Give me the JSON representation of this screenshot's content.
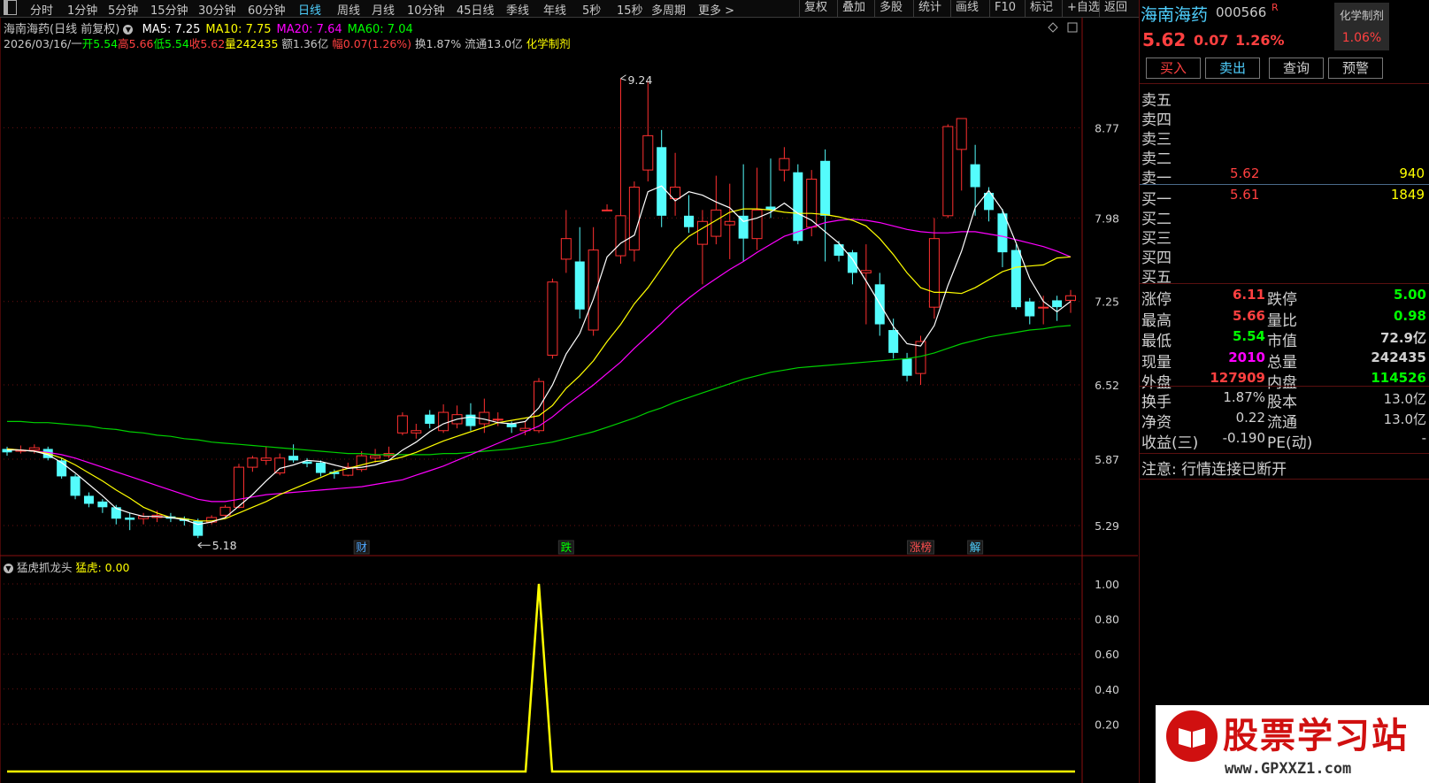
{
  "toolbar": {
    "menu_icon": "window-menu-icon",
    "periods": [
      "分时",
      "1分钟",
      "5分钟",
      "15分钟",
      "30分钟",
      "60分钟",
      "日线",
      "周线",
      "月线",
      "10分钟",
      "45日线",
      "季线",
      "年线",
      "5秒",
      "15秒",
      "多周期",
      "更多 >"
    ],
    "active_period": "日线",
    "right_buttons": [
      "复权",
      "叠加",
      "多股",
      "统计",
      "画线",
      "F10",
      "标记",
      "+自选",
      "返回"
    ]
  },
  "main_chart": {
    "title": "海南海药(日线 前复权)",
    "ma": [
      {
        "label": "MA5: 7.25",
        "color": "#ffffff"
      },
      {
        "label": "MA10: 7.75",
        "color": "#ffff00"
      },
      {
        "label": "MA20: 7.64",
        "color": "#ff00ff"
      },
      {
        "label": "MA60: 7.04",
        "color": "#00ff00"
      }
    ],
    "date": "2026/03/16/一",
    "open_label": "开",
    "open": "5.54",
    "high_label": "高",
    "high": "5.66",
    "low_label": "低",
    "low": "5.54",
    "close_label": "收",
    "close": "5.62",
    "vol_label": "量",
    "vol": "242435",
    "amount": "额1.36亿",
    "change_label": "幅",
    "change": "0.07(1.26%)",
    "turnover": "换1.87%",
    "float_shares": "流通13.0亿",
    "sector": "化学制剂",
    "high_marker": "9.24",
    "low_marker": "5.18",
    "event_tags": [
      {
        "text": "财",
        "color": "#4fa8ff"
      },
      {
        "text": "跌",
        "color": "#00ff00"
      },
      {
        "text": "涨榜",
        "color": "#ff5050"
      },
      {
        "text": "解",
        "color": "#4fd0ff"
      }
    ]
  },
  "sub_chart": {
    "title": "猛虎抓龙头",
    "value_label": "猛虎: 0.00",
    "signal_value": "1.00"
  },
  "chart_data": [
    {
      "type": "candlestick",
      "title": "海南海药(日线 前复权)",
      "y_ticks": [
        "8.77",
        "7.98",
        "7.25",
        "6.52",
        "5.87",
        "5.29"
      ],
      "ylim": [
        5.05,
        9.5
      ],
      "candles": [
        [
          5.96,
          5.93,
          5.98,
          5.9
        ],
        [
          5.94,
          5.95,
          5.99,
          5.92
        ],
        [
          5.95,
          5.97,
          6.0,
          5.92
        ],
        [
          5.96,
          5.88,
          5.98,
          5.86
        ],
        [
          5.86,
          5.72,
          5.88,
          5.7
        ],
        [
          5.72,
          5.55,
          5.74,
          5.52
        ],
        [
          5.55,
          5.48,
          5.58,
          5.45
        ],
        [
          5.5,
          5.45,
          5.52,
          5.4
        ],
        [
          5.45,
          5.35,
          5.47,
          5.3
        ],
        [
          5.36,
          5.34,
          5.4,
          5.25
        ],
        [
          5.35,
          5.37,
          5.4,
          5.3
        ],
        [
          5.36,
          5.38,
          5.42,
          5.32
        ],
        [
          5.37,
          5.35,
          5.4,
          5.32
        ],
        [
          5.35,
          5.33,
          5.37,
          5.29
        ],
        [
          5.33,
          5.2,
          5.35,
          5.18
        ],
        [
          5.32,
          5.36,
          5.38,
          5.3
        ],
        [
          5.38,
          5.45,
          5.47,
          5.36
        ],
        [
          5.45,
          5.8,
          5.83,
          5.44
        ],
        [
          5.8,
          5.88,
          5.9,
          5.76
        ],
        [
          5.86,
          5.88,
          5.98,
          5.82
        ],
        [
          5.75,
          5.88,
          5.92,
          5.73
        ],
        [
          5.9,
          5.86,
          6.0,
          5.84
        ],
        [
          5.85,
          5.83,
          5.88,
          5.8
        ],
        [
          5.84,
          5.75,
          5.86,
          5.72
        ],
        [
          5.76,
          5.74,
          5.78,
          5.7
        ],
        [
          5.73,
          5.8,
          5.84,
          5.72
        ],
        [
          5.78,
          5.9,
          5.94,
          5.76
        ],
        [
          5.88,
          5.9,
          5.96,
          5.84
        ],
        [
          5.9,
          5.92,
          5.98,
          5.88
        ],
        [
          6.1,
          6.25,
          6.28,
          6.08
        ],
        [
          6.1,
          6.12,
          6.18,
          6.05
        ],
        [
          6.26,
          6.18,
          6.3,
          6.14
        ],
        [
          6.12,
          6.28,
          6.35,
          6.1
        ],
        [
          6.18,
          6.26,
          6.34,
          6.14
        ],
        [
          6.26,
          6.16,
          6.36,
          6.12
        ],
        [
          6.18,
          6.28,
          6.4,
          6.1
        ],
        [
          6.22,
          6.22,
          6.28,
          6.16
        ],
        [
          6.18,
          6.15,
          6.2,
          6.1
        ],
        [
          6.12,
          6.14,
          6.2,
          6.08
        ],
        [
          6.12,
          6.55,
          6.58,
          6.1
        ],
        [
          6.78,
          7.42,
          7.45,
          6.75
        ],
        [
          7.62,
          7.8,
          8.05,
          7.5
        ],
        [
          7.6,
          7.18,
          7.9,
          7.1
        ],
        [
          7.0,
          7.7,
          7.9,
          6.95
        ],
        [
          8.05,
          8.05,
          8.1,
          8.05
        ],
        [
          7.65,
          8.0,
          9.2,
          7.58
        ],
        [
          7.7,
          8.25,
          8.3,
          7.6
        ],
        [
          8.4,
          8.7,
          9.18,
          8.3
        ],
        [
          8.6,
          8.0,
          8.75,
          7.9
        ],
        [
          8.15,
          8.25,
          8.55,
          8.0
        ],
        [
          8.0,
          7.9,
          8.18,
          7.85
        ],
        [
          7.75,
          7.95,
          8.05,
          7.4
        ],
        [
          7.82,
          8.05,
          8.35,
          7.75
        ],
        [
          7.92,
          7.95,
          8.28,
          7.62
        ],
        [
          8.0,
          7.8,
          8.45,
          7.6
        ],
        [
          7.8,
          8.05,
          8.42,
          7.7
        ],
        [
          8.08,
          8.05,
          8.5,
          7.98
        ],
        [
          8.4,
          8.5,
          8.6,
          8.3
        ],
        [
          8.38,
          7.78,
          8.45,
          7.75
        ],
        [
          7.9,
          8.32,
          8.4,
          7.82
        ],
        [
          8.48,
          8.0,
          8.58,
          7.6
        ],
        [
          7.75,
          7.65,
          7.78,
          7.6
        ],
        [
          7.68,
          7.5,
          7.7,
          7.4
        ],
        [
          7.5,
          7.52,
          7.75,
          7.05
        ],
        [
          7.4,
          7.05,
          7.5,
          6.95
        ],
        [
          7.0,
          6.8,
          7.1,
          6.75
        ],
        [
          6.75,
          6.6,
          6.8,
          6.55
        ],
        [
          6.62,
          6.9,
          6.95,
          6.52
        ],
        [
          7.2,
          7.8,
          7.98,
          7.1
        ],
        [
          8.0,
          8.78,
          8.8,
          7.98
        ],
        [
          8.58,
          8.85,
          8.75,
          8.22
        ],
        [
          8.45,
          8.25,
          8.62,
          8.0
        ],
        [
          8.2,
          8.05,
          8.25,
          7.95
        ],
        [
          8.02,
          7.68,
          8.06,
          7.55
        ],
        [
          7.7,
          7.2,
          7.75,
          7.18
        ],
        [
          7.25,
          7.12,
          7.28,
          7.05
        ],
        [
          7.2,
          7.2,
          7.3,
          7.05
        ],
        [
          7.26,
          7.2,
          7.3,
          7.08
        ],
        [
          7.26,
          7.3,
          7.35,
          7.15
        ]
      ],
      "ma5": [
        5.95,
        5.95,
        5.94,
        5.91,
        5.84,
        5.75,
        5.65,
        5.55,
        5.44,
        5.4,
        5.37,
        5.37,
        5.36,
        5.34,
        5.3,
        5.32,
        5.36,
        5.46,
        5.56,
        5.68,
        5.79,
        5.82,
        5.86,
        5.85,
        5.82,
        5.79,
        5.8,
        5.82,
        5.86,
        5.95,
        6.02,
        6.11,
        6.18,
        6.22,
        6.24,
        6.22,
        6.19,
        6.18,
        6.2,
        6.32,
        6.52,
        6.79,
        6.97,
        7.27,
        7.64,
        7.76,
        7.83,
        8.21,
        8.26,
        8.13,
        8.21,
        8.18,
        8.12,
        8.07,
        7.95,
        7.98,
        8.03,
        8.11,
        8.02,
        7.96,
        7.86,
        7.76,
        7.62,
        7.43,
        7.23,
        7.03,
        6.88,
        6.86,
        7.04,
        7.39,
        7.69,
        8.07,
        8.22,
        8.05,
        7.76,
        7.45,
        7.25,
        7.16,
        7.25
      ],
      "ma10": [
        5.96,
        5.95,
        5.94,
        5.92,
        5.88,
        5.82,
        5.75,
        5.68,
        5.6,
        5.53,
        5.45,
        5.4,
        5.36,
        5.35,
        5.33,
        5.33,
        5.35,
        5.4,
        5.45,
        5.5,
        5.56,
        5.61,
        5.66,
        5.71,
        5.76,
        5.79,
        5.82,
        5.85,
        5.86,
        5.89,
        5.93,
        5.98,
        6.03,
        6.07,
        6.11,
        6.15,
        6.19,
        6.21,
        6.23,
        6.25,
        6.34,
        6.49,
        6.6,
        6.73,
        6.9,
        7.05,
        7.23,
        7.37,
        7.54,
        7.71,
        7.82,
        7.89,
        7.96,
        8.03,
        8.06,
        8.06,
        8.05,
        8.03,
        8.02,
        8.02,
        8.01,
        7.99,
        7.96,
        7.91,
        7.8,
        7.66,
        7.5,
        7.37,
        7.33,
        7.33,
        7.32,
        7.37,
        7.44,
        7.51,
        7.55,
        7.56,
        7.57,
        7.63,
        7.64
      ],
      "ma20": [
        5.96,
        5.95,
        5.94,
        5.93,
        5.91,
        5.88,
        5.84,
        5.8,
        5.76,
        5.72,
        5.68,
        5.64,
        5.6,
        5.56,
        5.52,
        5.5,
        5.5,
        5.52,
        5.54,
        5.56,
        5.57,
        5.58,
        5.59,
        5.6,
        5.61,
        5.62,
        5.63,
        5.65,
        5.67,
        5.69,
        5.73,
        5.77,
        5.81,
        5.86,
        5.91,
        5.96,
        6.01,
        6.06,
        6.11,
        6.16,
        6.24,
        6.34,
        6.43,
        6.52,
        6.62,
        6.72,
        6.84,
        6.95,
        7.06,
        7.18,
        7.28,
        7.37,
        7.45,
        7.53,
        7.6,
        7.68,
        7.75,
        7.82,
        7.86,
        7.9,
        7.94,
        7.96,
        7.97,
        7.96,
        7.94,
        7.91,
        7.88,
        7.86,
        7.85,
        7.85,
        7.86,
        7.86,
        7.84,
        7.82,
        7.79,
        7.76,
        7.73,
        7.69,
        7.64
      ],
      "ma60": [
        6.2,
        6.2,
        6.19,
        6.19,
        6.18,
        6.17,
        6.16,
        6.14,
        6.13,
        6.11,
        6.1,
        6.08,
        6.07,
        6.05,
        6.04,
        6.02,
        6.01,
        6.0,
        5.99,
        5.98,
        5.97,
        5.96,
        5.95,
        5.94,
        5.93,
        5.92,
        5.92,
        5.91,
        5.91,
        5.91,
        5.91,
        5.91,
        5.92,
        5.92,
        5.93,
        5.94,
        5.95,
        5.96,
        5.98,
        6.0,
        6.02,
        6.05,
        6.08,
        6.11,
        6.15,
        6.19,
        6.23,
        6.28,
        6.32,
        6.37,
        6.41,
        6.45,
        6.49,
        6.53,
        6.57,
        6.6,
        6.63,
        6.65,
        6.67,
        6.68,
        6.69,
        6.7,
        6.71,
        6.72,
        6.73,
        6.74,
        6.75,
        6.77,
        6.8,
        6.84,
        6.88,
        6.91,
        6.94,
        6.96,
        6.98,
        7.0,
        7.01,
        7.03,
        7.04
      ]
    },
    {
      "type": "line",
      "title": "猛虎抓龙头",
      "y_ticks": [
        "1.00",
        "0.80",
        "0.60",
        "0.40",
        "0.20"
      ],
      "ylim": [
        0,
        1.0
      ],
      "series": [
        {
          "name": "猛虎",
          "spike_index": 39,
          "values_note_free": true
        }
      ]
    }
  ],
  "quote": {
    "name": "海南海药",
    "code": "000566",
    "mark": "R",
    "sector": "化学制剂",
    "sector_change": "1.06%",
    "price": "5.62",
    "change": "0.07",
    "change_pct": "1.26%",
    "buttons": [
      "买入",
      "卖出",
      "查询",
      "预警"
    ],
    "sells": [
      {
        "label": "卖五",
        "price": "",
        "vol": ""
      },
      {
        "label": "卖四",
        "price": "",
        "vol": ""
      },
      {
        "label": "卖三",
        "price": "",
        "vol": ""
      },
      {
        "label": "卖二",
        "price": "",
        "vol": ""
      },
      {
        "label": "卖一",
        "price": "5.62",
        "vol": "940"
      }
    ],
    "buys": [
      {
        "label": "买一",
        "price": "5.61",
        "vol": "1849"
      },
      {
        "label": "买二",
        "price": "",
        "vol": ""
      },
      {
        "label": "买三",
        "price": "",
        "vol": ""
      },
      {
        "label": "买四",
        "price": "",
        "vol": ""
      },
      {
        "label": "买五",
        "price": "",
        "vol": ""
      }
    ],
    "stats": [
      {
        "l1": "涨停",
        "v1": "6.11",
        "c1": "#ff4040",
        "l2": "跌停",
        "v2": "5.00",
        "c2": "#00ff00"
      },
      {
        "l1": "最高",
        "v1": "5.66",
        "c1": "#ff4040",
        "l2": "量比",
        "v2": "0.98",
        "c2": "#00ff00"
      },
      {
        "l1": "最低",
        "v1": "5.54",
        "c1": "#00ff00",
        "l2": "市值",
        "v2": "72.9亿",
        "c2": "#d0d0d0"
      },
      {
        "l1": "现量",
        "v1": "2010",
        "c1": "#ff00ff",
        "l2": "总量",
        "v2": "242435",
        "c2": "#d0d0d0"
      },
      {
        "l1": "外盘",
        "v1": "127909",
        "c1": "#ff4040",
        "l2": "内盘",
        "v2": "114526",
        "c2": "#00ff00"
      }
    ],
    "stats2": [
      {
        "l1": "换手",
        "v1": "1.87%",
        "l2": "股本",
        "v2": "13.0亿"
      },
      {
        "l1": "净资",
        "v1": "0.22",
        "l2": "流通",
        "v2": "13.0亿"
      },
      {
        "l1": "收益(三)",
        "v1": "-0.190",
        "l2": "PE(动)",
        "v2": "-"
      }
    ],
    "notice": "注意: 行情连接已断开"
  },
  "watermark": {
    "site": "股票学习站",
    "url": "www.GPXXZ1.com"
  }
}
